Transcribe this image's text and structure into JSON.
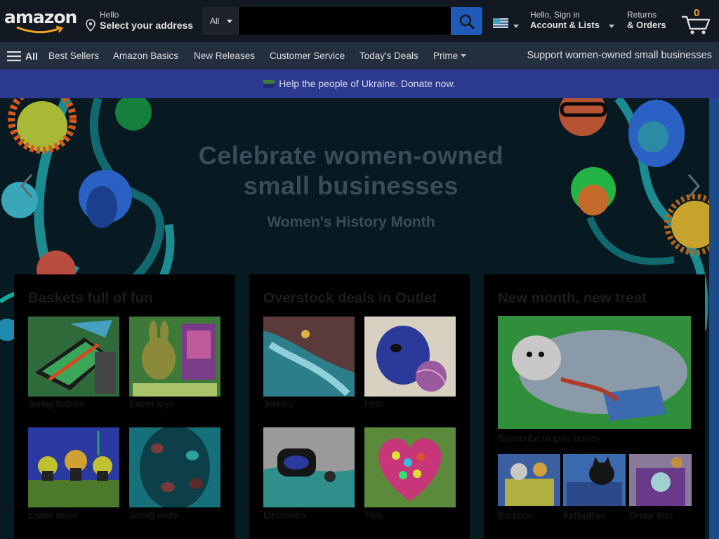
{
  "header": {
    "logo_text": "amazon",
    "location": {
      "hello": "Hello",
      "address": "Select your address"
    },
    "search": {
      "category": "All",
      "placeholder": ""
    },
    "account": {
      "line1": "Hello, Sign in",
      "line2": "Account & Lists"
    },
    "orders": {
      "line1": "Returns",
      "line2": "& Orders"
    },
    "cart": {
      "count": "0"
    }
  },
  "nav": {
    "all_label": "All",
    "items": [
      "Best Sellers",
      "Amazon Basics",
      "New Releases",
      "Customer Service",
      "Today's Deals",
      "Prime"
    ],
    "promo": "Support women-owned small businesses"
  },
  "banner": {
    "text": "Help the people of Ukraine. Donate now."
  },
  "hero": {
    "title_line1": "Celebrate women-owned",
    "title_line2": "small businesses",
    "subtitle": "Women's History Month"
  },
  "cards": [
    {
      "title": "Baskets full of fun",
      "tiles": [
        {
          "label": "Spring fashion"
        },
        {
          "label": "Easter toys"
        },
        {
          "label": "Easter décor"
        },
        {
          "label": "Spring crafts"
        }
      ]
    },
    {
      "title": "Overstock deals in Outlet",
      "tiles": [
        {
          "label": "Jewelry"
        },
        {
          "label": "Pets"
        },
        {
          "label": "Electronics"
        },
        {
          "label": "Toys"
        }
      ]
    },
    {
      "title": "New month, new treat",
      "main_label": "Subscribe to pets boxes",
      "tiles": [
        {
          "label": "Barkbox"
        },
        {
          "label": "KitNipBox"
        },
        {
          "label": "Gnaw Box"
        }
      ]
    }
  ],
  "colors": {
    "header_bg": "#131921",
    "nav_bg": "#232f3e",
    "banner_bg": "#2b3990",
    "search_button": "#1f5ab8",
    "cart_count": "#f2a31d"
  }
}
